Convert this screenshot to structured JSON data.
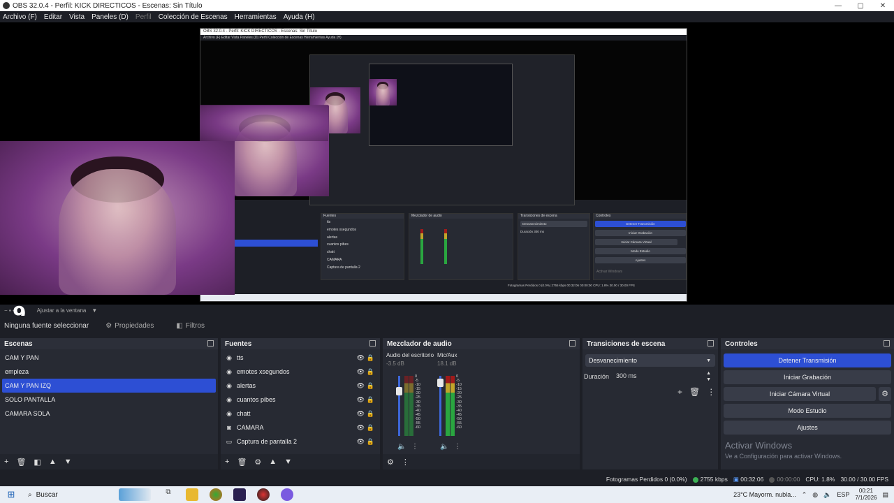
{
  "window": {
    "title": "OBS 32.0.4 - Perfil: KICK DIRECTICOS - Escenas: Sin Título",
    "controls": [
      "—",
      "▢",
      "✕"
    ]
  },
  "menu": [
    "Archivo (F)",
    "Editar",
    "Vista",
    "Paneles (D)",
    "Perfil",
    "Colección de Escenas",
    "Herramientas",
    "Ayuda (H)"
  ],
  "zoom": {
    "label": "Ajustar a la ventana",
    "overlay_digit": "9"
  },
  "source_bar": {
    "no_source": "Ninguna fuente seleccionar",
    "properties": "Propiedades",
    "filters": "Filtros"
  },
  "scenes": {
    "title": "Escenas",
    "items": [
      "CAM Y PAN",
      "empleza",
      "CAM Y PAN IZQ",
      "SOLO PANTALLA",
      "CAMARA SOLA"
    ],
    "selected": "CAM Y PAN IZQ"
  },
  "sources": {
    "title": "Fuentes",
    "items": [
      {
        "name": "tts",
        "icon": "browser-icon"
      },
      {
        "name": "emotes xsegundos",
        "icon": "browser-icon"
      },
      {
        "name": "alertas",
        "icon": "browser-icon"
      },
      {
        "name": "cuantos pibes",
        "icon": "browser-icon"
      },
      {
        "name": "chatt",
        "icon": "browser-icon"
      },
      {
        "name": "CAMARA",
        "icon": "camera-icon"
      },
      {
        "name": "Captura de pantalla 2",
        "icon": "monitor-icon"
      }
    ]
  },
  "mixer": {
    "title": "Mezclador de audio",
    "channels": [
      {
        "name": "Audio del escritorio",
        "db": "-3.5 dB",
        "fader_level": 0.78
      },
      {
        "name": "Mic/Aux",
        "db": "18.1 dB",
        "fader_level": 0.95
      }
    ],
    "scale": [
      "0",
      "-5",
      "-10",
      "-15",
      "-20",
      "-25",
      "-30",
      "-35",
      "-40",
      "-45",
      "-50",
      "-55",
      "-60"
    ]
  },
  "transitions": {
    "title": "Transiciones de escena",
    "selected": "Desvanecimiento",
    "duration_label": "Duración",
    "duration_value": "300 ms"
  },
  "controls": {
    "title": "Controles",
    "stop_stream": "Detener Transmisión",
    "start_record": "Iniciar Grabación",
    "start_virtualcam": "Iniciar Cámara Virtual",
    "studio_mode": "Modo Estudio",
    "settings": "Ajustes",
    "activate_title": "Activar Windows",
    "activate_sub": "Ve a Configuración para activar Windows."
  },
  "status": {
    "dropped": "Fotogramas Perdidos 0 (0.0%)",
    "bitrate": "2755 kbps",
    "stream_time": "00:32:06",
    "rec_time": "00:00:00",
    "cpu": "CPU: 1.8%",
    "fps": "30.00 / 30.00 FPS"
  },
  "taskbar": {
    "search": "Buscar",
    "weather": "23°C  Mayorm. nubla...",
    "lang": "ESP",
    "time": "00:21",
    "date": "7/1/2026"
  },
  "nested": {
    "title": "OBS 32.0.4 - Perfil: KICK DIRECTICOS - Escenas: Sin Título",
    "menu": "Archivo (F)   Editar   Vista   Paneles (D)   Perfil   Colección de Escenas   Herramientas   Ayuda (H)",
    "sources_title": "Fuentes",
    "mixer_title": "Mezclador de audio",
    "transitions_title": "Transiciones de escena",
    "controls_title": "Controles",
    "stop_stream": "Detener Transmisión",
    "start_record": "Iniciar Grabación",
    "start_virtualcam": "Iniciar Cámara Virtual",
    "studio_mode": "Modo Estudio",
    "settings": "Ajustes",
    "transition": "Desvanecimiento",
    "duration": "Duración   300 ms",
    "activate": "Activar Windows",
    "status": "Fotogramas Perdidos 0 (0.0%)   2755 kbps   00:32:06   00:00:00   CPU: 1.8%   30.00 / 30.00 FPS",
    "sources": [
      "tts",
      "emotes xsegundos",
      "alertas",
      "cuantos pibes",
      "chatt",
      "CAMARA",
      "Captura de pantalla 2"
    ]
  }
}
